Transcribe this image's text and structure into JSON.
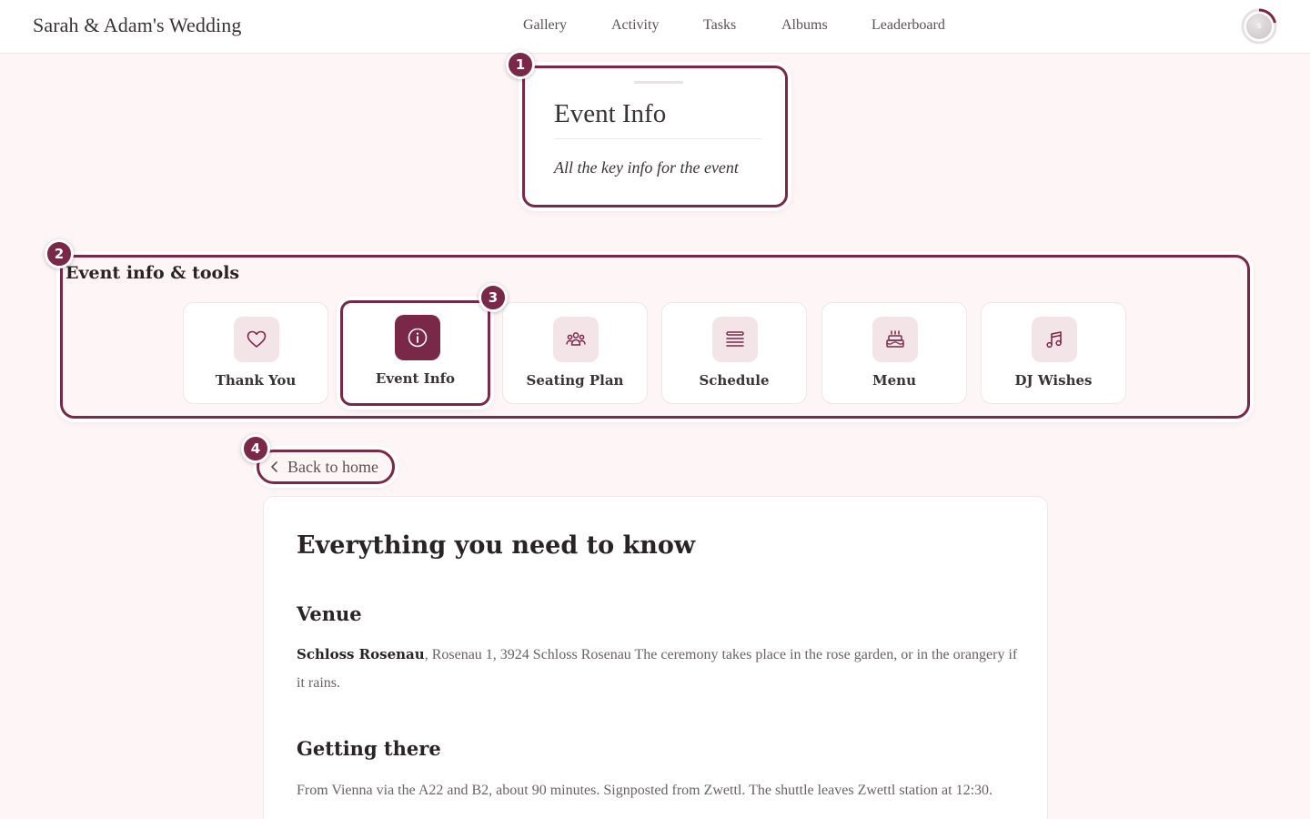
{
  "header": {
    "brand": "Sarah & Adam's Wedding",
    "nav": [
      "Gallery",
      "Activity",
      "Tasks",
      "Albums",
      "Leaderboard"
    ],
    "avatar_initial": "s"
  },
  "markers": [
    "1",
    "2",
    "3",
    "4"
  ],
  "hero": {
    "title": "Event Info",
    "subtitle": "All the key info for the event"
  },
  "tools": {
    "title": "Event info & tools",
    "items": [
      {
        "label": "Thank You",
        "icon": "heart-icon",
        "active": false
      },
      {
        "label": "Event Info",
        "icon": "info-icon",
        "active": true
      },
      {
        "label": "Seating Plan",
        "icon": "people-icon",
        "active": false
      },
      {
        "label": "Schedule",
        "icon": "list-icon",
        "active": false
      },
      {
        "label": "Menu",
        "icon": "cake-icon",
        "active": false
      },
      {
        "label": "DJ Wishes",
        "icon": "music-note-icon",
        "active": false
      }
    ]
  },
  "back": {
    "label": "Back to home"
  },
  "content": {
    "heading": "Everything you need to know",
    "venue": {
      "heading": "Venue",
      "name": "Schloss Rosenau",
      "text": ", Rosenau 1, 3924 Schloss Rosenau The ceremony takes place in the rose garden, or in the orangery if it rains."
    },
    "getting_there": {
      "heading": "Getting there",
      "text": "From Vienna via the A22 and B2, about 90 minutes. Signposted from Zwettl. The shuttle leaves Zwettl station at 12:30."
    }
  },
  "colors": {
    "accent": "#7a2848",
    "background": "#fdf5f6",
    "icon_tint": "#f3e4e8"
  }
}
